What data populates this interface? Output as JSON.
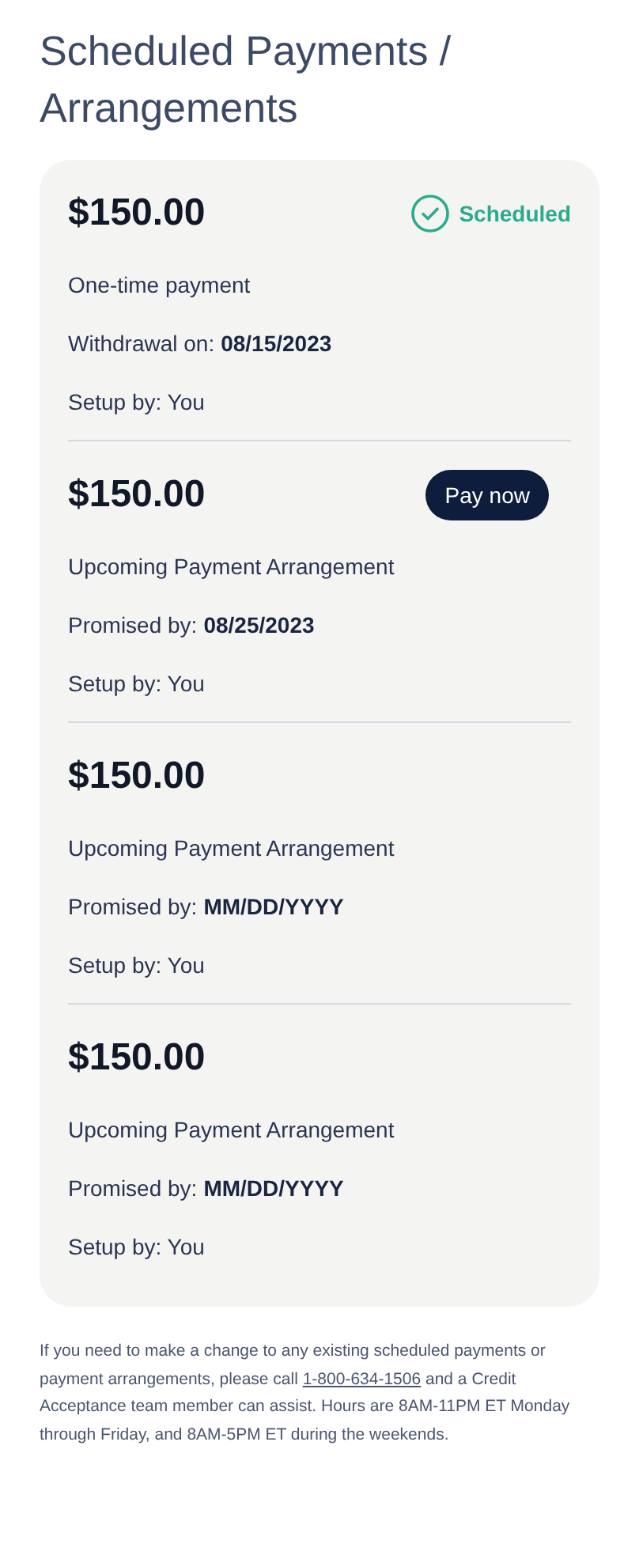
{
  "title": "Scheduled Payments / Arrangements",
  "payments": [
    {
      "amount": "$150.00",
      "badge": {
        "kind": "status",
        "label": "Scheduled"
      },
      "description": "One-time payment",
      "date_label": "Withdrawal on:",
      "date": "08/15/2023",
      "setup": "Setup by: You"
    },
    {
      "amount": "$150.00",
      "badge": {
        "kind": "button",
        "label": "Pay now"
      },
      "description": "Upcoming Payment Arrangement",
      "date_label": "Promised by:",
      "date": "08/25/2023",
      "setup": "Setup by: You"
    },
    {
      "amount": "$150.00",
      "description": "Upcoming Payment Arrangement",
      "date_label": "Promised by:",
      "date": "MM/DD/YYYY",
      "setup": "Setup by: You"
    },
    {
      "amount": "$150.00",
      "description": "Upcoming Payment Arrangement",
      "date_label": "Promised by:",
      "date": "MM/DD/YYYY",
      "setup": "Setup by: You"
    }
  ],
  "footer": {
    "before": "If you need to make a change to any existing scheduled payments or payment arrangements, please call",
    "phone": "1-800-634-1506",
    "after": "and a Credit Acceptance team member can assist. Hours are 8AM-11PM ET Monday through Friday, and 8AM-5PM ET during the weekends."
  }
}
